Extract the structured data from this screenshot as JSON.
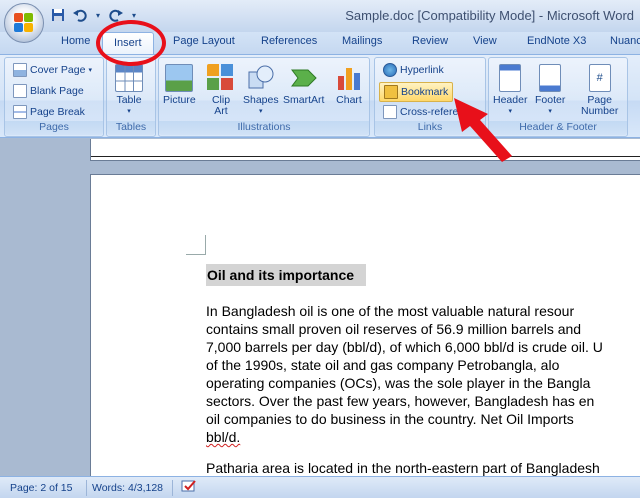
{
  "window": {
    "title": "Sample.doc [Compatibility Mode] - Microsoft Word"
  },
  "quick_access": {
    "icons": [
      "save-icon",
      "undo-icon",
      "redo-icon",
      "dropdown-icon"
    ]
  },
  "tabs": [
    {
      "label": "Home"
    },
    {
      "label": "Insert",
      "active": true
    },
    {
      "label": "Page Layout"
    },
    {
      "label": "References"
    },
    {
      "label": "Mailings"
    },
    {
      "label": "Review"
    },
    {
      "label": "View"
    },
    {
      "label": "EndNote X3"
    },
    {
      "label": "Nuance"
    }
  ],
  "ribbon": {
    "pages": {
      "label": "Pages",
      "cover_page": "Cover Page",
      "blank_page": "Blank Page",
      "page_break": "Page Break"
    },
    "tables": {
      "label": "Tables",
      "table": "Table"
    },
    "illustrations": {
      "label": "Illustrations",
      "picture": "Picture",
      "clip_art_1": "Clip",
      "clip_art_2": "Art",
      "shapes": "Shapes",
      "smartart": "SmartArt",
      "chart": "Chart"
    },
    "links": {
      "label": "Links",
      "hyperlink": "Hyperlink",
      "bookmark": "Bookmark",
      "cross_reference": "Cross-reference"
    },
    "header_footer": {
      "label": "Header & Footer",
      "header": "Header",
      "footer": "Footer",
      "page_number_1": "Page",
      "page_number_2": "Number"
    }
  },
  "document": {
    "heading": "Oil and its importance",
    "paragraph_lines": [
      "In Bangladesh oil is one of the most valuable natural resour",
      "contains small proven oil reserves of 56.9 million barrels and",
      "7,000 barrels per day (bbl/d), of which 6,000 bbl/d is crude oil. U",
      "of the 1990s, state oil and gas company Petrobangla, alo",
      "operating companies (OCs), was the sole player in the Bangla",
      "sectors. Over the past few years, however, Bangladesh has en",
      "oil companies to do business in the country. Net Oil Imports",
      "bbl/d."
    ],
    "paragraph2": "Patharia area is located in the north-eastern part of Bangladesh"
  },
  "statusbar": {
    "page": "Page: 2 of 15",
    "words": "Words: 4/3,128"
  },
  "colors": {
    "annotation": "#e8101a",
    "ribbon_text": "#15428b"
  }
}
